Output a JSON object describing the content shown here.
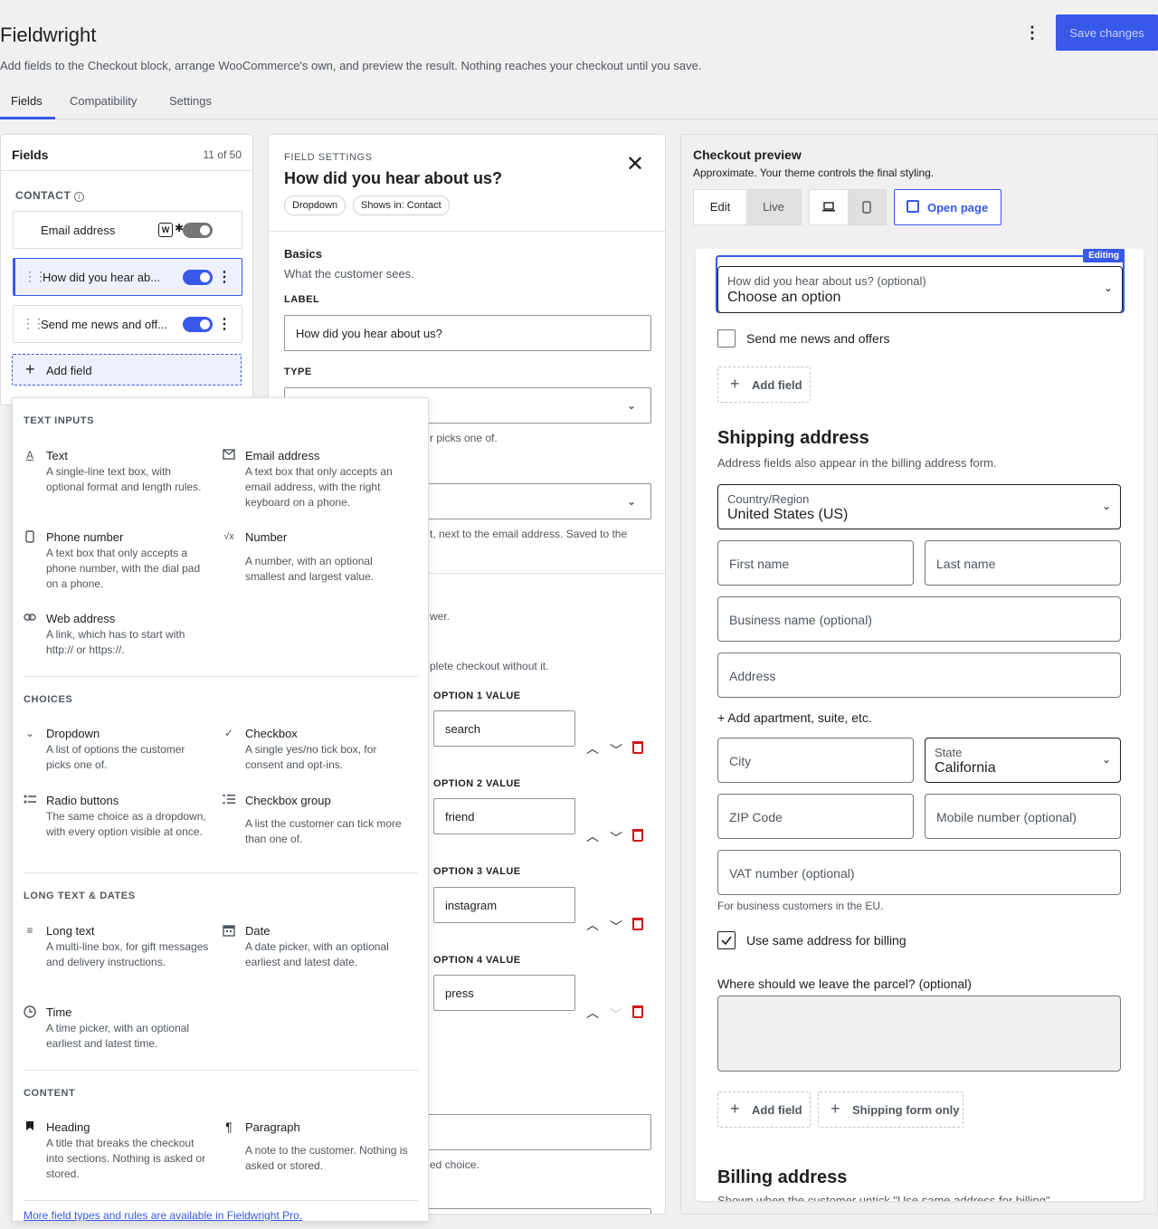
{
  "app": {
    "title": "Fieldwright",
    "subtitle": "Add fields to the Checkout block, arrange WooCommerce's own, and preview the result. Nothing reaches your checkout until you save.",
    "save_label": "Save changes",
    "kebab": "⋮"
  },
  "tabs": [
    {
      "label": "Fields",
      "active": true
    },
    {
      "label": "Compatibility",
      "active": false
    },
    {
      "label": "Settings",
      "active": false
    }
  ],
  "fields_panel": {
    "title": "Fields",
    "count": "11 of 50",
    "section": "CONTACT",
    "rows": [
      {
        "label": "Email address",
        "badge": "W",
        "star": "✱",
        "enabled": false
      },
      {
        "label": "How did you hear ab...",
        "enabled": true,
        "selected": true
      },
      {
        "label": "Send me news and off...",
        "enabled": true
      }
    ],
    "add_field": "Add field"
  },
  "field_settings": {
    "eyebrow": "FIELD SETTINGS",
    "title": "How did you hear about us?",
    "chips": [
      "Dropdown",
      "Shows in: Contact"
    ],
    "basics_heading": "Basics",
    "basics_desc": "What the customer sees.",
    "label_label": "LABEL",
    "label_value": "How did you hear about us?",
    "type_label": "TYPE",
    "type_help_fragment": "r picks one of.",
    "placement_help_fragment": "t, next to the email address. Saved to the",
    "answer_fragment": "wer.",
    "required_fragment": "plete checkout without it.",
    "options": [
      {
        "label": "OPTION 1 VALUE",
        "value": "search"
      },
      {
        "label": "OPTION 2 VALUE",
        "value": "friend"
      },
      {
        "label": "OPTION 3 VALUE",
        "value": "instagram"
      },
      {
        "label": "OPTION 4 VALUE",
        "value": "press"
      }
    ],
    "default_help_fragment": "ed choice."
  },
  "add_menu": {
    "sections": [
      {
        "title": "TEXT INPUTS"
      },
      {
        "title": "CHOICES"
      },
      {
        "title": "LONG TEXT & DATES"
      },
      {
        "title": "CONTENT"
      }
    ],
    "items": {
      "text": {
        "title": "Text",
        "desc": "A single-line text box, with optional format and length rules.",
        "icon": "A"
      },
      "email": {
        "title": "Email address",
        "desc": "A text box that only accepts an email address, with the right keyboard on a phone.",
        "icon": "envelope-icon"
      },
      "phone": {
        "title": "Phone number",
        "desc": "A text box that only accepts a phone number, with the dial pad on a phone.",
        "icon": "phone-icon"
      },
      "number": {
        "title": "Number",
        "desc": "A number, with an optional smallest and largest value.",
        "icon": "√x"
      },
      "web": {
        "title": "Web address",
        "desc": "A link, which has to start with http:// or https://.",
        "icon": "link-icon"
      },
      "dropdown": {
        "title": "Dropdown",
        "desc": "A list of options the customer picks one of.",
        "icon": "⌄"
      },
      "checkbox": {
        "title": "Checkbox",
        "desc": "A single yes/no tick box, for consent and opt-ins.",
        "icon": "✓"
      },
      "radio": {
        "title": "Radio buttons",
        "desc": "The same choice as a dropdown, with every option visible at once.",
        "icon": "radio-list-icon"
      },
      "checkgroup": {
        "title": "Checkbox group",
        "desc": "A list the customer can tick more than one of.",
        "icon": "check-list-icon"
      },
      "longtext": {
        "title": "Long text",
        "desc": "A multi-line box, for gift messages and delivery instructions.",
        "icon": "≡"
      },
      "date": {
        "title": "Date",
        "desc": "A date picker, with an optional earliest and latest date.",
        "icon": "calendar-icon"
      },
      "time": {
        "title": "Time",
        "desc": "A time picker, with an optional earliest and latest time.",
        "icon": "clock-icon"
      },
      "heading": {
        "title": "Heading",
        "desc": "A title that breaks the checkout into sections. Nothing is asked or stored.",
        "icon": "bookmark-icon"
      },
      "paragraph": {
        "title": "Paragraph",
        "desc": "A note to the customer. Nothing is asked or stored.",
        "icon": "¶"
      }
    },
    "pro_link": "More field types and rules are available in Fieldwright Pro."
  },
  "preview": {
    "title": "Checkout preview",
    "subtitle": "Approximate. Your theme controls the final styling.",
    "mode_edit": "Edit",
    "mode_live": "Live",
    "open_page": "Open page",
    "editing_badge": "Editing",
    "hear_label": "How did you hear about us? (optional)",
    "hear_value": "Choose an option",
    "news_label": "Send me news and offers",
    "add_field": "Add field",
    "shipping_heading": "Shipping address",
    "shipping_desc": "Address fields also appear in the billing address form.",
    "country_label": "Country/Region",
    "country_value": "United States (US)",
    "first_name": "First name",
    "last_name": "Last name",
    "business": "Business name (optional)",
    "address": "Address",
    "add_apartment": "+ Add apartment, suite, etc.",
    "city": "City",
    "state_label": "State",
    "state_value": "California",
    "zip": "ZIP Code",
    "mobile": "Mobile number (optional)",
    "vat": "VAT number (optional)",
    "vat_help": "For business customers in the EU.",
    "same_billing": "Use same address for billing",
    "parcel_label": "Where should we leave the parcel? (optional)",
    "shipping_only": "Shipping form only",
    "billing_heading": "Billing address",
    "billing_desc": "Shown when the customer untick \"Use same address for billing\"."
  },
  "colors": {
    "accent": "#3858e9",
    "danger": "#cc1818"
  }
}
